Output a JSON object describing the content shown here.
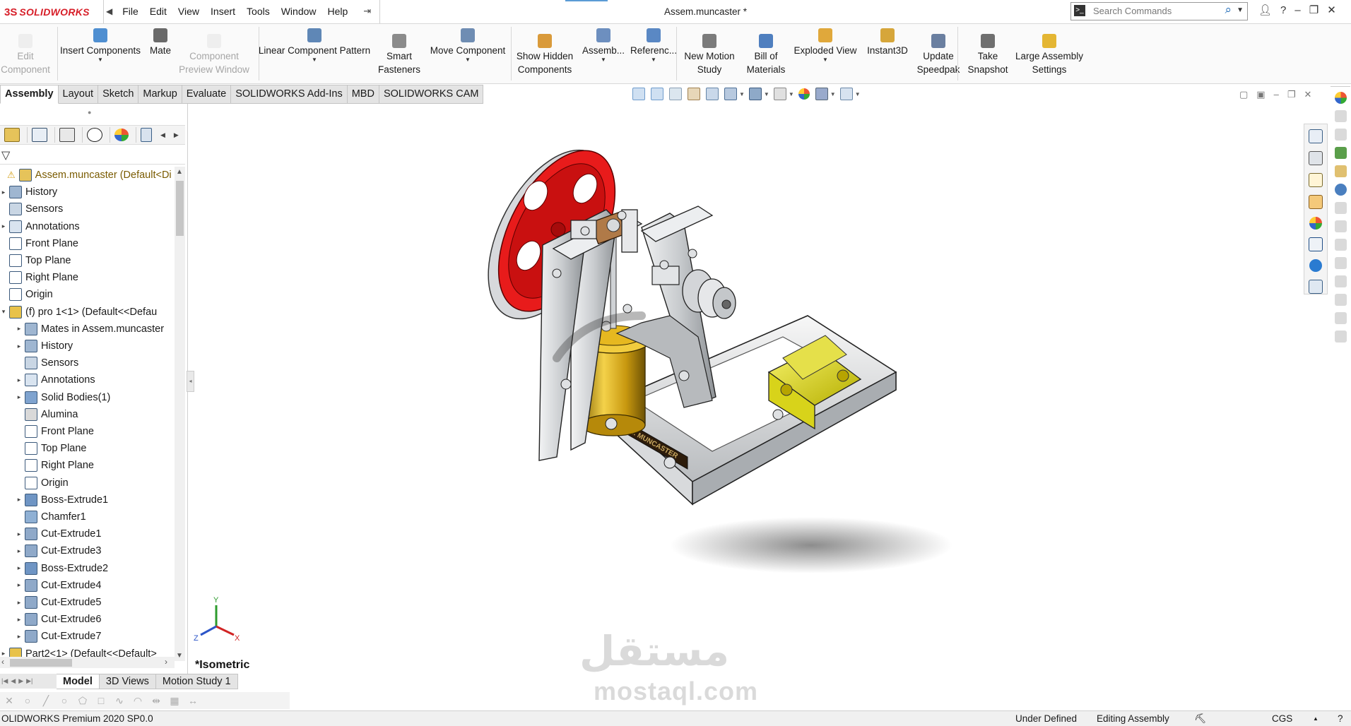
{
  "app": {
    "logo": {
      "ds": "3S",
      "name": "SOLIDWORKS"
    },
    "menu": [
      "File",
      "Edit",
      "View",
      "Insert",
      "Tools",
      "Window",
      "Help"
    ],
    "document_title": "Assem.muncaster *",
    "search_placeholder": "Search Commands",
    "window_controls": [
      "?",
      "–",
      "❐",
      "✕"
    ]
  },
  "command_manager": [
    {
      "label": "Edit\nComponent",
      "disabled": true,
      "icon": "edit-component-icon"
    },
    {
      "label": "Insert Components",
      "dropdown": true,
      "icon": "insert-components-icon"
    },
    {
      "label": "Mate",
      "icon": "mate-icon"
    },
    {
      "label": "Component\nPreview Window",
      "disabled": true,
      "icon": "component-preview-icon"
    },
    {
      "label": "Linear Component Pattern",
      "dropdown": true,
      "icon": "linear-pattern-icon"
    },
    {
      "label": "Smart\nFasteners",
      "icon": "smart-fasteners-icon"
    },
    {
      "label": "Move Component",
      "dropdown": true,
      "icon": "move-component-icon"
    },
    {
      "label": "Show Hidden\nComponents",
      "icon": "show-hidden-icon"
    },
    {
      "label": "Assemb...",
      "dropdown": true,
      "icon": "assembly-features-icon"
    },
    {
      "label": "Referenc...",
      "dropdown": true,
      "icon": "reference-geometry-icon"
    },
    {
      "label": "New Motion\nStudy",
      "icon": "motion-study-icon"
    },
    {
      "label": "Bill of\nMaterials",
      "icon": "bom-icon"
    },
    {
      "label": "Exploded View",
      "dropdown": true,
      "icon": "exploded-view-icon"
    },
    {
      "label": "Instant3D",
      "icon": "instant3d-icon"
    },
    {
      "label": "Update\nSpeedpak",
      "icon": "speedpak-icon"
    },
    {
      "label": "Take\nSnapshot",
      "icon": "snapshot-icon"
    },
    {
      "label": "Large Assembly\nSettings",
      "icon": "large-assembly-icon"
    }
  ],
  "tabs": [
    "Assembly",
    "Layout",
    "Sketch",
    "Markup",
    "Evaluate",
    "SOLIDWORKS Add-Ins",
    "MBD",
    "SOLIDWORKS CAM"
  ],
  "active_tab": "Assembly",
  "feature_tree": [
    {
      "label": "Assem.muncaster  (Default<Di",
      "level": 0,
      "twisty": "",
      "icon": "assembly-warning-icon",
      "warn": true
    },
    {
      "label": "History",
      "level": 0,
      "twisty": "▸",
      "icon": "history-icon"
    },
    {
      "label": "Sensors",
      "level": 0,
      "twisty": "",
      "icon": "sensors-icon"
    },
    {
      "label": "Annotations",
      "level": 0,
      "twisty": "▸",
      "icon": "annotations-icon"
    },
    {
      "label": "Front Plane",
      "level": 0,
      "twisty": "",
      "icon": "plane-icon"
    },
    {
      "label": "Top Plane",
      "level": 0,
      "twisty": "",
      "icon": "plane-icon"
    },
    {
      "label": "Right Plane",
      "level": 0,
      "twisty": "",
      "icon": "plane-icon"
    },
    {
      "label": "Origin",
      "level": 0,
      "twisty": "",
      "icon": "origin-icon"
    },
    {
      "label": "(f) pro 1<1> (Default<<Defau",
      "level": 0,
      "twisty": "▾",
      "icon": "part-icon"
    },
    {
      "label": "Mates in Assem.muncaster",
      "level": 1,
      "twisty": "▸",
      "icon": "mates-icon"
    },
    {
      "label": "History",
      "level": 1,
      "twisty": "▸",
      "icon": "history-icon"
    },
    {
      "label": "Sensors",
      "level": 1,
      "twisty": "",
      "icon": "sensors-icon"
    },
    {
      "label": "Annotations",
      "level": 1,
      "twisty": "▸",
      "icon": "annotations-icon"
    },
    {
      "label": "Solid Bodies(1)",
      "level": 1,
      "twisty": "▸",
      "icon": "solid-bodies-icon"
    },
    {
      "label": "Alumina",
      "level": 1,
      "twisty": "",
      "icon": "material-icon"
    },
    {
      "label": "Front Plane",
      "level": 1,
      "twisty": "",
      "icon": "plane-icon"
    },
    {
      "label": "Top Plane",
      "level": 1,
      "twisty": "",
      "icon": "plane-icon"
    },
    {
      "label": "Right Plane",
      "level": 1,
      "twisty": "",
      "icon": "plane-icon"
    },
    {
      "label": "Origin",
      "level": 1,
      "twisty": "",
      "icon": "origin-icon"
    },
    {
      "label": "Boss-Extrude1",
      "level": 1,
      "twisty": "▸",
      "icon": "boss-extrude-icon"
    },
    {
      "label": "Chamfer1",
      "level": 1,
      "twisty": "",
      "icon": "chamfer-icon"
    },
    {
      "label": "Cut-Extrude1",
      "level": 1,
      "twisty": "▸",
      "icon": "cut-extrude-icon"
    },
    {
      "label": "Cut-Extrude3",
      "level": 1,
      "twisty": "▸",
      "icon": "cut-extrude-icon"
    },
    {
      "label": "Boss-Extrude2",
      "level": 1,
      "twisty": "▸",
      "icon": "boss-extrude-icon"
    },
    {
      "label": "Cut-Extrude4",
      "level": 1,
      "twisty": "▸",
      "icon": "cut-extrude-icon"
    },
    {
      "label": "Cut-Extrude5",
      "level": 1,
      "twisty": "▸",
      "icon": "cut-extrude-icon"
    },
    {
      "label": "Cut-Extrude6",
      "level": 1,
      "twisty": "▸",
      "icon": "cut-extrude-icon"
    },
    {
      "label": "Cut-Extrude7",
      "level": 1,
      "twisty": "▸",
      "icon": "cut-extrude-icon"
    },
    {
      "label": "Part2<1> (Default<<Default>",
      "level": 0,
      "twisty": "▸",
      "icon": "part-icon"
    }
  ],
  "viewport": {
    "view_name": "*Isometric",
    "triad": {
      "x": "X",
      "y": "Y",
      "z": "Z"
    },
    "nameplate": "H. MUNCASTER",
    "watermark_ar": "مستقل",
    "watermark_en": "mostaql.com"
  },
  "bottom_tabs": [
    "Model",
    "3D Views",
    "Motion Study 1"
  ],
  "active_bottom_tab": "Model",
  "status": {
    "product": "OLIDWORKS Premium 2020 SP0.0",
    "definition": "Under Defined",
    "mode": "Editing Assembly",
    "units": "CGS"
  },
  "colors": {
    "brand": "#d71e28",
    "flywheel": "#e81b1b",
    "brass": "#e0b21a",
    "yellow_block": "#e8e21c",
    "frame": "#d2d4d6"
  }
}
